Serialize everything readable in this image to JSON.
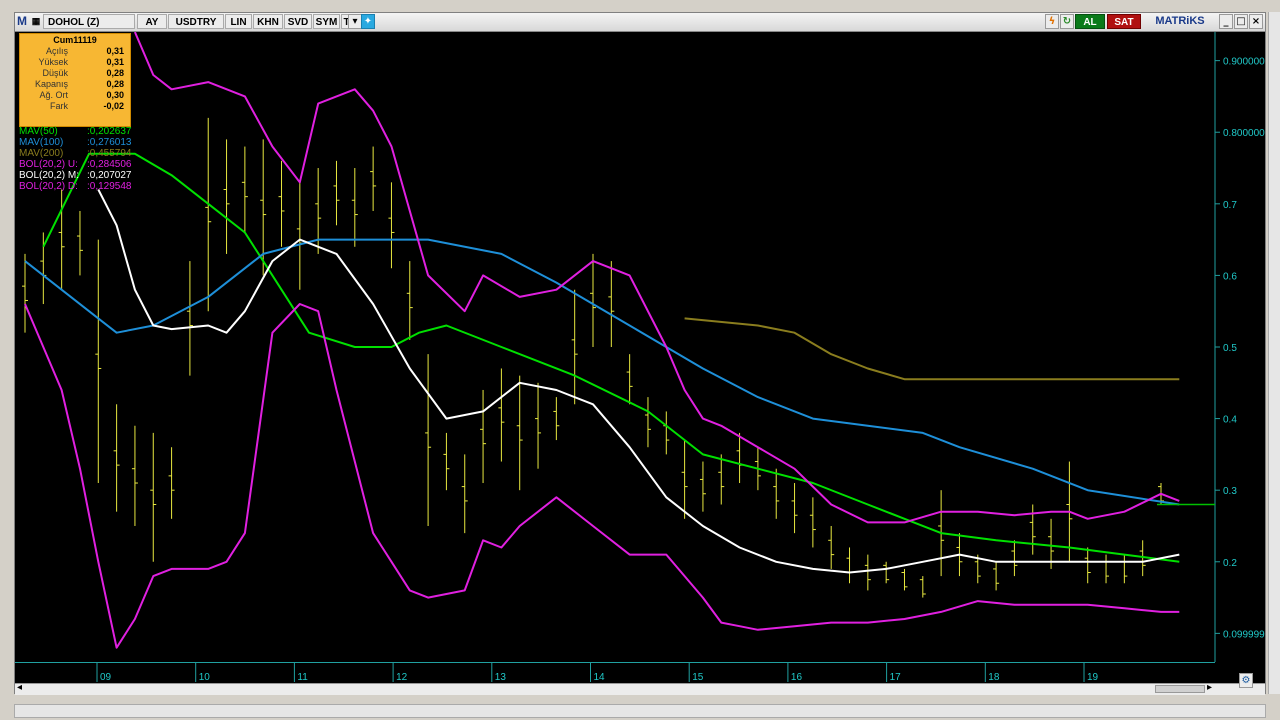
{
  "toolbar": {
    "m_label": "M",
    "symbol": "DOHOL (Z)",
    "period": "AY",
    "currency": "USDTRY",
    "buttons": [
      "LIN",
      "KHN",
      "SVD",
      "SYM",
      "TMP"
    ],
    "buy_label": "AL",
    "sell_label": "SAT",
    "brand": "MATRiKS",
    "win_min": "_",
    "win_max": "□",
    "win_close": "×"
  },
  "info": {
    "title": "Cum11119",
    "rows": [
      {
        "label": "Açılış",
        "value": "0,31"
      },
      {
        "label": "Yüksek",
        "value": "0,31"
      },
      {
        "label": "Düşük",
        "value": "0,28"
      },
      {
        "label": "Kapanış",
        "value": "0,28"
      },
      {
        "label": "Ağ. Ort",
        "value": "0,30"
      },
      {
        "label": "Fark",
        "value": "-0,02"
      }
    ]
  },
  "legend": [
    {
      "name": "MAV(50)",
      "value": ":0,202637",
      "color": "#00e000"
    },
    {
      "name": "MAV(100)",
      "value": ":0,276013",
      "color": "#1e8fd8"
    },
    {
      "name": "MAV(200)",
      "value": ":0,455794",
      "color": "#8a7d1e"
    },
    {
      "name": "BOL(20,2) U:",
      "value": ":0,284506",
      "color": "#e020e0"
    },
    {
      "name": "BOL(20,2) M:",
      "value": ":0,207027",
      "color": "#ffffff"
    },
    {
      "name": "BOL(20,2) D:",
      "value": ":0,129548",
      "color": "#e020e0"
    }
  ],
  "colors": {
    "price": "#e8e840",
    "mav50": "#00e000",
    "mav100": "#1e8fd8",
    "mav200": "#8a7d1e",
    "bol_band": "#e020e0",
    "bol_mid": "#ffffff",
    "axis_text": "#20c8c8",
    "last_price_line": "#00c000"
  },
  "chart_data": {
    "type": "line",
    "x_ticks": [
      "09",
      "10",
      "11",
      "12",
      "13",
      "14",
      "15",
      "16",
      "17",
      "18",
      "19"
    ],
    "y_ticks": [
      "0.900000",
      "0.800000",
      "0.7",
      "0.6",
      "0.5",
      "0.4",
      "0.3",
      "0.2",
      "0.099999"
    ],
    "ylim": [
      0.06,
      0.94
    ],
    "last_price": 0.28,
    "series": [
      {
        "name": "MAV(50)",
        "points": [
          [
            1,
            0.64
          ],
          [
            3.5,
            0.77
          ],
          [
            6,
            0.77
          ],
          [
            8,
            0.74
          ],
          [
            10,
            0.7
          ],
          [
            12,
            0.66
          ],
          [
            13.5,
            0.6
          ],
          [
            15.5,
            0.52
          ],
          [
            18,
            0.5
          ],
          [
            20,
            0.5
          ],
          [
            21.5,
            0.52
          ],
          [
            23,
            0.53
          ],
          [
            26,
            0.5
          ],
          [
            30,
            0.46
          ],
          [
            34,
            0.41
          ],
          [
            37,
            0.35
          ],
          [
            40,
            0.33
          ],
          [
            43,
            0.31
          ],
          [
            46,
            0.28
          ],
          [
            48,
            0.26
          ],
          [
            50,
            0.24
          ],
          [
            53,
            0.23
          ],
          [
            57,
            0.22
          ],
          [
            60,
            0.21
          ],
          [
            63,
            0.2
          ]
        ]
      },
      {
        "name": "MAV(100)",
        "points": [
          [
            0,
            0.62
          ],
          [
            2,
            0.58
          ],
          [
            4,
            0.54
          ],
          [
            5,
            0.52
          ],
          [
            7,
            0.53
          ],
          [
            10,
            0.57
          ],
          [
            13,
            0.63
          ],
          [
            16,
            0.65
          ],
          [
            20,
            0.65
          ],
          [
            22,
            0.65
          ],
          [
            26,
            0.63
          ],
          [
            29,
            0.59
          ],
          [
            33,
            0.53
          ],
          [
            37,
            0.47
          ],
          [
            40,
            0.43
          ],
          [
            43,
            0.4
          ],
          [
            46,
            0.39
          ],
          [
            49,
            0.38
          ],
          [
            51,
            0.36
          ],
          [
            55,
            0.33
          ],
          [
            58,
            0.3
          ],
          [
            63,
            0.28
          ]
        ]
      },
      {
        "name": "MAV(200)",
        "points": [
          [
            36,
            0.54
          ],
          [
            40,
            0.53
          ],
          [
            42,
            0.52
          ],
          [
            44,
            0.49
          ],
          [
            46,
            0.47
          ],
          [
            48,
            0.455
          ],
          [
            52,
            0.455
          ],
          [
            56,
            0.455
          ],
          [
            63,
            0.455
          ]
        ]
      },
      {
        "name": "BOL(20,2) U",
        "points": [
          [
            6,
            0.94
          ],
          [
            7,
            0.88
          ],
          [
            8,
            0.86
          ],
          [
            10,
            0.87
          ],
          [
            12,
            0.85
          ],
          [
            13.5,
            0.78
          ],
          [
            15,
            0.73
          ],
          [
            16,
            0.84
          ],
          [
            18,
            0.86
          ],
          [
            19,
            0.83
          ],
          [
            20,
            0.78
          ],
          [
            22,
            0.6
          ],
          [
            24,
            0.55
          ],
          [
            25,
            0.6
          ],
          [
            27,
            0.57
          ],
          [
            29,
            0.58
          ],
          [
            31,
            0.62
          ],
          [
            33,
            0.6
          ],
          [
            35,
            0.5
          ],
          [
            36,
            0.44
          ],
          [
            37,
            0.4
          ],
          [
            38,
            0.39
          ],
          [
            40,
            0.36
          ],
          [
            42,
            0.33
          ],
          [
            44,
            0.28
          ],
          [
            46,
            0.255
          ],
          [
            48,
            0.255
          ],
          [
            50,
            0.27
          ],
          [
            52,
            0.27
          ],
          [
            54,
            0.265
          ],
          [
            56,
            0.27
          ],
          [
            57,
            0.27
          ],
          [
            58,
            0.26
          ],
          [
            60,
            0.27
          ],
          [
            62,
            0.295
          ],
          [
            63,
            0.285
          ]
        ]
      },
      {
        "name": "BOL(20,2) M",
        "points": [
          [
            4,
            0.72
          ],
          [
            5,
            0.67
          ],
          [
            6,
            0.58
          ],
          [
            7,
            0.53
          ],
          [
            8,
            0.525
          ],
          [
            10,
            0.53
          ],
          [
            11,
            0.52
          ],
          [
            12,
            0.55
          ],
          [
            13.5,
            0.62
          ],
          [
            15,
            0.65
          ],
          [
            17,
            0.63
          ],
          [
            19,
            0.56
          ],
          [
            21,
            0.47
          ],
          [
            23,
            0.4
          ],
          [
            25,
            0.41
          ],
          [
            27,
            0.45
          ],
          [
            29,
            0.44
          ],
          [
            31,
            0.42
          ],
          [
            33,
            0.36
          ],
          [
            35,
            0.29
          ],
          [
            37,
            0.25
          ],
          [
            39,
            0.22
          ],
          [
            41,
            0.2
          ],
          [
            43,
            0.19
          ],
          [
            45,
            0.185
          ],
          [
            47,
            0.19
          ],
          [
            49,
            0.2
          ],
          [
            51,
            0.21
          ],
          [
            53,
            0.2
          ],
          [
            55,
            0.2
          ],
          [
            57,
            0.2
          ],
          [
            59,
            0.2
          ],
          [
            61,
            0.2
          ],
          [
            63,
            0.21
          ]
        ]
      },
      {
        "name": "BOL(20,2) D",
        "points": [
          [
            0,
            0.56
          ],
          [
            1,
            0.5
          ],
          [
            2,
            0.44
          ],
          [
            3,
            0.33
          ],
          [
            4,
            0.2
          ],
          [
            5,
            0.08
          ],
          [
            6,
            0.12
          ],
          [
            7,
            0.18
          ],
          [
            8,
            0.19
          ],
          [
            10,
            0.19
          ],
          [
            11,
            0.2
          ],
          [
            12,
            0.24
          ],
          [
            13.5,
            0.52
          ],
          [
            15,
            0.56
          ],
          [
            16,
            0.55
          ],
          [
            17,
            0.44
          ],
          [
            18,
            0.34
          ],
          [
            19,
            0.24
          ],
          [
            20,
            0.2
          ],
          [
            21,
            0.16
          ],
          [
            22,
            0.15
          ],
          [
            24,
            0.16
          ],
          [
            25,
            0.23
          ],
          [
            26,
            0.22
          ],
          [
            27,
            0.25
          ],
          [
            29,
            0.29
          ],
          [
            31,
            0.25
          ],
          [
            33,
            0.21
          ],
          [
            35,
            0.21
          ],
          [
            37,
            0.15
          ],
          [
            38,
            0.115
          ],
          [
            39,
            0.11
          ],
          [
            40,
            0.105
          ],
          [
            42,
            0.11
          ],
          [
            44,
            0.115
          ],
          [
            46,
            0.115
          ],
          [
            48,
            0.12
          ],
          [
            50,
            0.13
          ],
          [
            52,
            0.145
          ],
          [
            54,
            0.14
          ],
          [
            56,
            0.14
          ],
          [
            58,
            0.14
          ],
          [
            60,
            0.135
          ],
          [
            62,
            0.13
          ],
          [
            63,
            0.13
          ]
        ]
      }
    ],
    "price_bars": [
      [
        0.63,
        0.52
      ],
      [
        0.66,
        0.56
      ],
      [
        0.72,
        0.58
      ],
      [
        0.69,
        0.6
      ],
      [
        0.65,
        0.31
      ],
      [
        0.42,
        0.27
      ],
      [
        0.39,
        0.25
      ],
      [
        0.38,
        0.2
      ],
      [
        0.36,
        0.26
      ],
      [
        0.62,
        0.46
      ],
      [
        0.82,
        0.55
      ],
      [
        0.79,
        0.63
      ],
      [
        0.78,
        0.66
      ],
      [
        0.79,
        0.6
      ],
      [
        0.76,
        0.64
      ],
      [
        0.73,
        0.58
      ],
      [
        0.75,
        0.63
      ],
      [
        0.76,
        0.67
      ],
      [
        0.75,
        0.64
      ],
      [
        0.78,
        0.69
      ],
      [
        0.73,
        0.61
      ],
      [
        0.62,
        0.51
      ],
      [
        0.49,
        0.25
      ],
      [
        0.38,
        0.3
      ],
      [
        0.35,
        0.24
      ],
      [
        0.44,
        0.31
      ],
      [
        0.47,
        0.34
      ],
      [
        0.46,
        0.3
      ],
      [
        0.45,
        0.33
      ],
      [
        0.43,
        0.37
      ],
      [
        0.58,
        0.42
      ],
      [
        0.63,
        0.5
      ],
      [
        0.62,
        0.5
      ],
      [
        0.49,
        0.42
      ],
      [
        0.43,
        0.36
      ],
      [
        0.41,
        0.35
      ],
      [
        0.37,
        0.26
      ],
      [
        0.34,
        0.27
      ],
      [
        0.35,
        0.28
      ],
      [
        0.38,
        0.31
      ],
      [
        0.36,
        0.3
      ],
      [
        0.33,
        0.26
      ],
      [
        0.31,
        0.24
      ],
      [
        0.29,
        0.22
      ],
      [
        0.25,
        0.19
      ],
      [
        0.22,
        0.17
      ],
      [
        0.21,
        0.16
      ],
      [
        0.2,
        0.17
      ],
      [
        0.19,
        0.16
      ],
      [
        0.18,
        0.15
      ],
      [
        0.3,
        0.18
      ],
      [
        0.24,
        0.18
      ],
      [
        0.21,
        0.17
      ],
      [
        0.2,
        0.16
      ],
      [
        0.23,
        0.18
      ],
      [
        0.28,
        0.21
      ],
      [
        0.26,
        0.19
      ],
      [
        0.34,
        0.2
      ],
      [
        0.22,
        0.17
      ],
      [
        0.21,
        0.17
      ],
      [
        0.21,
        0.17
      ],
      [
        0.23,
        0.18
      ],
      [
        0.31,
        0.28
      ]
    ]
  },
  "scroll": {
    "left": "◂",
    "right": "▸"
  }
}
